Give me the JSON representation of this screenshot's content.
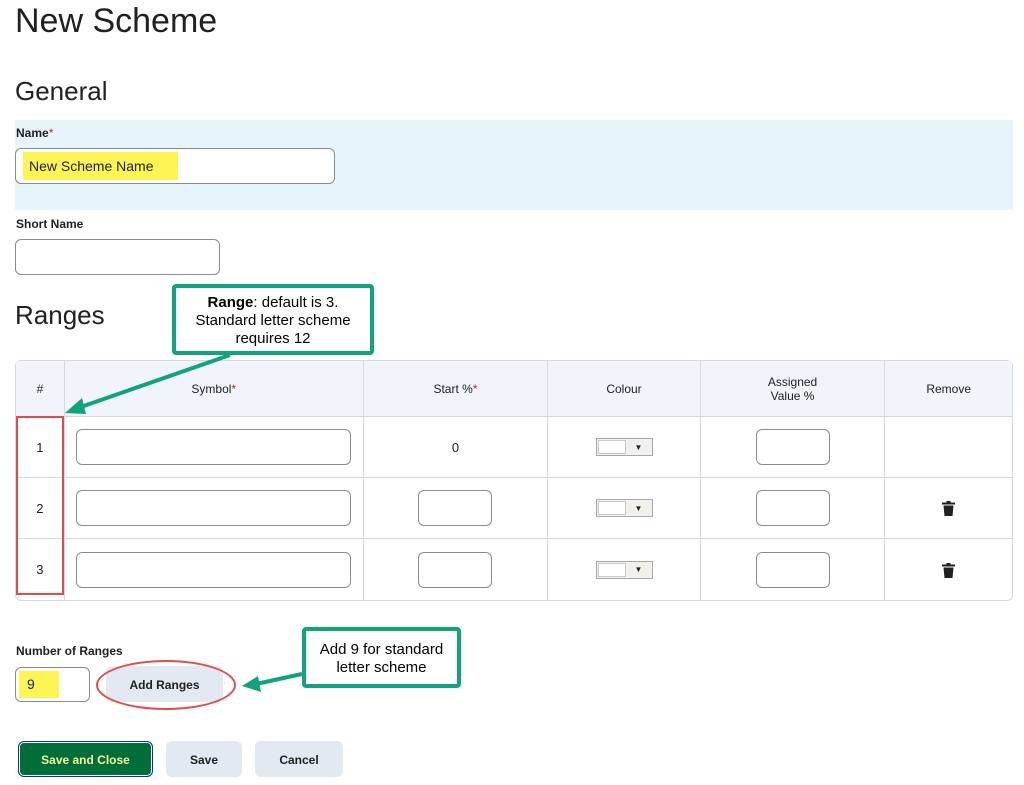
{
  "page": {
    "title": "New Scheme"
  },
  "general": {
    "heading": "General",
    "name_label": "Name",
    "name_required": "*",
    "name_value": "New Scheme Name",
    "short_name_label": "Short Name",
    "short_name_value": ""
  },
  "ranges": {
    "heading": "Ranges",
    "columns": {
      "index": "#",
      "symbol": "Symbol",
      "symbol_required": "*",
      "start": "Start %",
      "start_required": "*",
      "colour": "Colour",
      "assigned_line1": "Assigned",
      "assigned_line2": "Value %",
      "remove": "Remove"
    },
    "rows": [
      {
        "index": "1",
        "start": "0"
      },
      {
        "index": "2"
      },
      {
        "index": "3"
      }
    ],
    "number_label": "Number of Ranges",
    "number_value": "9",
    "add_button": "Add Ranges"
  },
  "callouts": {
    "range_bold": "Range",
    "range_rest": ": default is 3.",
    "range_line2": "Standard letter scheme",
    "range_line3": "requires 12",
    "add_line1": "Add 9 for standard",
    "add_line2": "letter scheme"
  },
  "actions": {
    "save_close": "Save and Close",
    "save": "Save",
    "cancel": "Cancel"
  },
  "colors": {
    "highlight": "#fdf554",
    "callout_border": "#12a37e",
    "annotation_red": "#e04c4c",
    "primary_button": "#006e3a"
  },
  "icons": {
    "colour_dropdown": "caret-down-icon",
    "remove": "trash-icon"
  }
}
